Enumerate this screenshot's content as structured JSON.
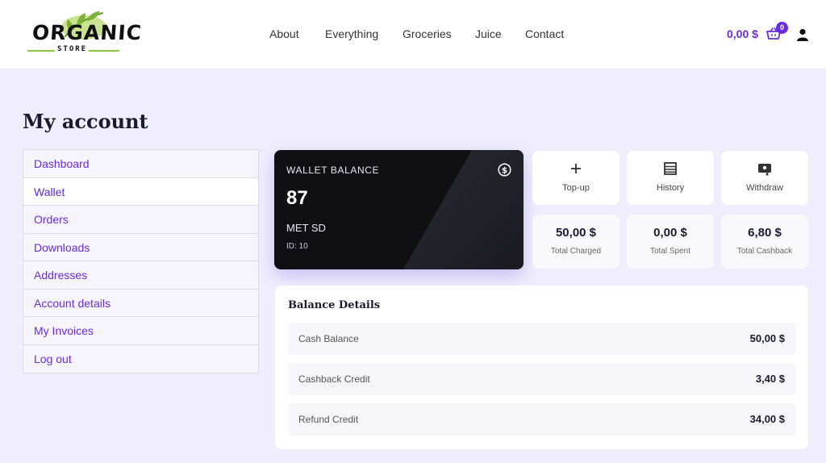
{
  "brand": {
    "logo_main": "ORGANIC",
    "logo_sub": "STORE",
    "leaf_color": "#8cc63f"
  },
  "nav": {
    "items": [
      "About",
      "Everything",
      "Groceries",
      "Juice",
      "Contact"
    ]
  },
  "header": {
    "cart_total": "0,00 $",
    "cart_count": "0",
    "accent": "#6a2bdc",
    "cart_icon": "basket-icon",
    "user_icon": "user-icon"
  },
  "page": {
    "title": "My account"
  },
  "sidebar": {
    "items": [
      {
        "label": "Dashboard",
        "active": false
      },
      {
        "label": "Wallet",
        "active": true
      },
      {
        "label": "Orders",
        "active": false
      },
      {
        "label": "Downloads",
        "active": false
      },
      {
        "label": "Addresses",
        "active": false
      },
      {
        "label": "Account details",
        "active": false
      },
      {
        "label": "My Invoices",
        "active": false
      },
      {
        "label": "Log out",
        "active": false
      }
    ]
  },
  "wallet": {
    "label": "WALLET BALANCE",
    "amount": "87",
    "holder": "MET SD",
    "id": "ID: 10",
    "icon": "dollar-circle-icon"
  },
  "actions": [
    {
      "label": "Top-up",
      "icon": "plus-icon"
    },
    {
      "label": "History",
      "icon": "list-icon"
    },
    {
      "label": "Withdraw",
      "icon": "withdraw-icon"
    }
  ],
  "stats": [
    {
      "value": "50,00 $",
      "label": "Total Charged"
    },
    {
      "value": "0,00 $",
      "label": "Total Spent"
    },
    {
      "value": "6,80 $",
      "label": "Total Cashback"
    }
  ],
  "balance_details": {
    "title": "Balance Details",
    "rows": [
      {
        "label": "Cash Balance",
        "value": "50,00 $"
      },
      {
        "label": "Cashback Credit",
        "value": "3,40 $"
      },
      {
        "label": "Refund Credit",
        "value": "34,00 $"
      }
    ]
  }
}
